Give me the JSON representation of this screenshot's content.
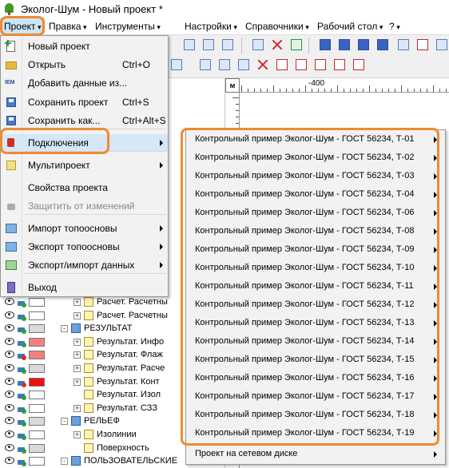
{
  "window": {
    "title": "Эколог-Шум - Новый проект *"
  },
  "menubar": [
    {
      "label": "Проект",
      "active": true
    },
    {
      "label": "Правка"
    },
    {
      "label": "Инструменты"
    },
    {
      "label": "Настройки"
    },
    {
      "label": "Справочники"
    },
    {
      "label": "Рабочий стол"
    },
    {
      "label": "?"
    }
  ],
  "project_menu": {
    "items": [
      {
        "label": "Новый проект",
        "shortcut": "",
        "icon": "new-project-icon"
      },
      {
        "label": "Открыть",
        "shortcut": "Ctrl+O",
        "icon": "open-folder-icon"
      },
      {
        "label": "Добавить данные из...",
        "shortcut": "",
        "icon": "iem-import-icon"
      },
      {
        "label": "Сохранить проект",
        "shortcut": "Ctrl+S",
        "icon": "save-disk-icon"
      },
      {
        "label": "Сохранить как...",
        "shortcut": "Ctrl+Alt+S",
        "icon": "save-as-icon"
      },
      {
        "label": "Подключения",
        "shortcut": "",
        "icon": "plug-icon",
        "submenu": true
      },
      {
        "label": "Мультипроект",
        "shortcut": "",
        "icon": "multiproject-icon",
        "submenu": true
      },
      {
        "label": "Свойства проекта",
        "shortcut": "",
        "icon": ""
      },
      {
        "label": "Защитить от изменений",
        "shortcut": "",
        "icon": "lock-icon",
        "disabled": true
      },
      {
        "label": "Импорт топоосновы",
        "shortcut": "",
        "icon": "import-map-icon",
        "submenu": true
      },
      {
        "label": "Экспорт топоосновы",
        "shortcut": "",
        "icon": "export-map-icon",
        "submenu": true
      },
      {
        "label": "Экспорт/импорт данных",
        "shortcut": "",
        "icon": "exchange-icon",
        "submenu": true
      },
      {
        "label": "Выход",
        "shortcut": "",
        "icon": "exit-icon"
      }
    ]
  },
  "connections_submenu": {
    "items": [
      "Контрольный пример Эколог-Шум - ГОСТ 56234, Т-01",
      "Контрольный пример Эколог-Шум - ГОСТ 56234, Т-02",
      "Контрольный пример Эколог-Шум - ГОСТ 56234, Т-03",
      "Контрольный пример Эколог-Шум - ГОСТ 56234, Т-04",
      "Контрольный пример Эколог-Шум - ГОСТ 56234, Т-06",
      "Контрольный пример Эколог-Шум - ГОСТ 56234, Т-08",
      "Контрольный пример Эколог-Шум - ГОСТ 56234, Т-09",
      "Контрольный пример Эколог-Шум - ГОСТ 56234, Т-10",
      "Контрольный пример Эколог-Шум - ГОСТ 56234, Т-11",
      "Контрольный пример Эколог-Шум - ГОСТ 56234, Т-12",
      "Контрольный пример Эколог-Шум - ГОСТ 56234, Т-13",
      "Контрольный пример Эколог-Шум - ГОСТ 56234, Т-14",
      "Контрольный пример Эколог-Шум - ГОСТ 56234, Т-15",
      "Контрольный пример Эколог-Шум - ГОСТ 56234, Т-16",
      "Контрольный пример Эколог-Шум - ГОСТ 56234, Т-17",
      "Контрольный пример Эколог-Шум - ГОСТ 56234, Т-18",
      "Контрольный пример Эколог-Шум - ГОСТ 56234, Т-19",
      "Проект на сетевом диске"
    ]
  },
  "ruler": {
    "corner": "м",
    "label": "-400"
  },
  "tree": {
    "rows": [
      {
        "label": "Расчет. Расчетны",
        "swatch": "#ffffff",
        "lock": "green",
        "indent": 1,
        "expander": "+"
      },
      {
        "label": "Расчет. Расчетны",
        "swatch": "#ffffff",
        "lock": "green",
        "indent": 1,
        "expander": "+"
      },
      {
        "label": "РЕЗУЛЬТАТ",
        "swatch": "#d9d9d9",
        "lock": "green",
        "indent": 0,
        "expander": "-"
      },
      {
        "label": "Результат. Инфо",
        "swatch": "#f28080",
        "lock": "green",
        "indent": 1,
        "expander": "+"
      },
      {
        "label": "Результат. Флаж",
        "swatch": "#f28080",
        "lock": "red",
        "indent": 1,
        "expander": "+"
      },
      {
        "label": "Результат. Расче",
        "swatch": "#d9d9d9",
        "lock": "green",
        "indent": 1,
        "expander": "+"
      },
      {
        "label": "Результат. Конт",
        "swatch": "#ee1111",
        "lock": "red",
        "indent": 1,
        "expander": "+"
      },
      {
        "label": "Результат. Изол",
        "swatch": "#ffffff",
        "lock": "green",
        "indent": 1,
        "expander": ""
      },
      {
        "label": "Результат. СЗЗ",
        "swatch": "#ffffff",
        "lock": "green",
        "indent": 1,
        "expander": "+"
      },
      {
        "label": "РЕЛЬЕФ",
        "swatch": "#d9d9d9",
        "lock": "green",
        "indent": 0,
        "expander": "-"
      },
      {
        "label": "Изолинии",
        "swatch": "#ffffff",
        "lock": "green",
        "indent": 1,
        "expander": "+"
      },
      {
        "label": "Поверхность",
        "swatch": "#d9d9d9",
        "lock": "green",
        "indent": 1,
        "expander": ""
      },
      {
        "label": "ПОЛЬЗОВАТЕЛЬСКИЕ",
        "swatch": "#ffffff",
        "lock": "green",
        "indent": 0,
        "expander": "-"
      }
    ]
  },
  "colors": {
    "highlight": "#f08a2e",
    "menu_hover": "#d5e7f8"
  }
}
